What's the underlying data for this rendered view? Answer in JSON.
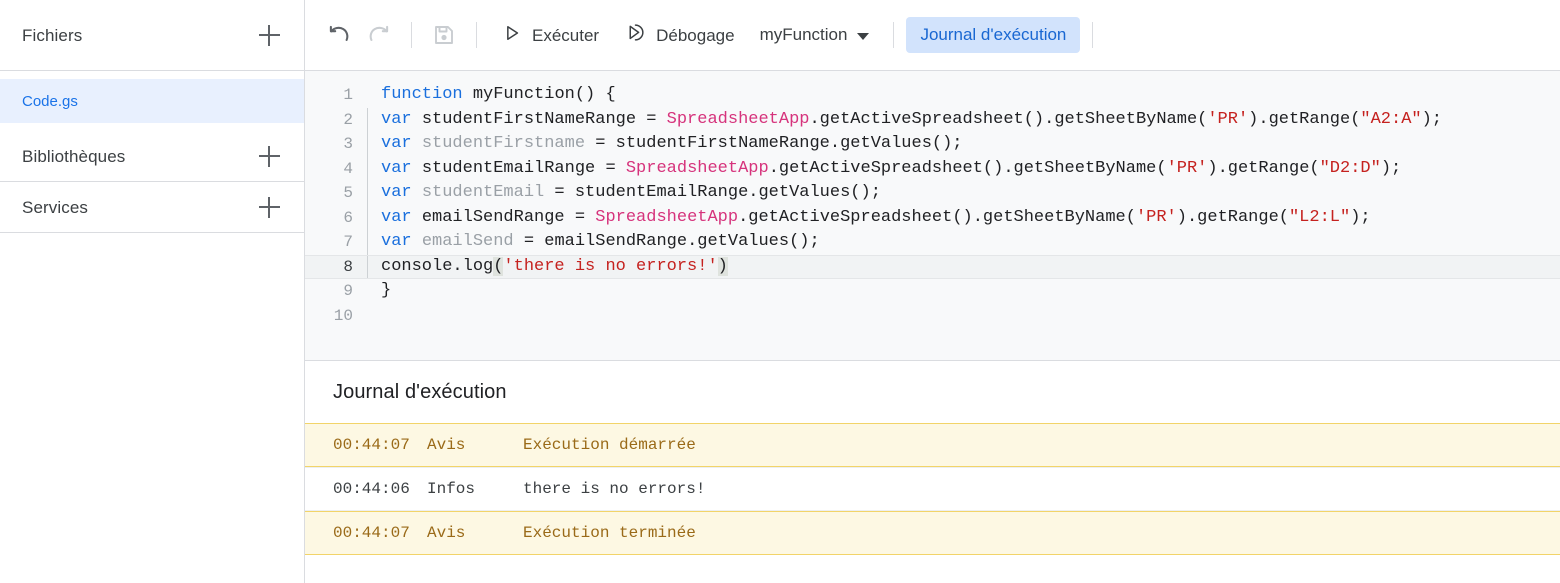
{
  "sidebar": {
    "sections": [
      {
        "title": "Fichiers",
        "add_icon": "plus-icon"
      },
      {
        "title": "Bibliothèques",
        "add_icon": "plus-icon"
      },
      {
        "title": "Services",
        "add_icon": "plus-icon"
      }
    ],
    "files": [
      {
        "name": "Code.gs",
        "selected": true
      }
    ]
  },
  "toolbar": {
    "undo_icon": "undo-icon",
    "redo_icon": "redo-icon",
    "save_icon": "save-icon",
    "run_label": "Exécuter",
    "run_icon": "play-icon",
    "debug_label": "Débogage",
    "debug_icon": "debug-icon",
    "function_selected": "myFunction",
    "function_caret_icon": "chevron-down-icon",
    "log_tab_label": "Journal d'exécution"
  },
  "editor": {
    "language": "javascript",
    "active_line": 8,
    "total_lines": 10,
    "lines": [
      {
        "n": "1",
        "depth": 0,
        "tokens": [
          {
            "t": "function ",
            "c": "kw"
          },
          {
            "t": "myFunction() {",
            "c": "plain"
          }
        ]
      },
      {
        "n": "2",
        "depth": 1,
        "tokens": [
          {
            "t": "var ",
            "c": "kw"
          },
          {
            "t": "studentFirstNameRange = ",
            "c": "plain"
          },
          {
            "t": "SpreadsheetApp",
            "c": "cls"
          },
          {
            "t": ".getActiveSpreadsheet().getSheetByName(",
            "c": "plain"
          },
          {
            "t": "'PR'",
            "c": "str"
          },
          {
            "t": ").getRange(",
            "c": "plain"
          },
          {
            "t": "\"A2:A\"",
            "c": "str"
          },
          {
            "t": ");",
            "c": "plain"
          }
        ]
      },
      {
        "n": "3",
        "depth": 1,
        "tokens": [
          {
            "t": "var ",
            "c": "kw"
          },
          {
            "t": "studentFirstname",
            "c": "dim"
          },
          {
            "t": " = studentFirstNameRange.getValues();",
            "c": "plain"
          }
        ]
      },
      {
        "n": "4",
        "depth": 1,
        "tokens": [
          {
            "t": "var ",
            "c": "kw"
          },
          {
            "t": "studentEmailRange = ",
            "c": "plain"
          },
          {
            "t": "SpreadsheetApp",
            "c": "cls"
          },
          {
            "t": ".getActiveSpreadsheet().getSheetByName(",
            "c": "plain"
          },
          {
            "t": "'PR'",
            "c": "str"
          },
          {
            "t": ").getRange(",
            "c": "plain"
          },
          {
            "t": "\"D2:D\"",
            "c": "str"
          },
          {
            "t": ");",
            "c": "plain"
          }
        ]
      },
      {
        "n": "5",
        "depth": 1,
        "tokens": [
          {
            "t": "var ",
            "c": "kw"
          },
          {
            "t": "studentEmail",
            "c": "dim"
          },
          {
            "t": " = studentEmailRange.getValues();",
            "c": "plain"
          }
        ]
      },
      {
        "n": "6",
        "depth": 1,
        "tokens": [
          {
            "t": "var ",
            "c": "kw"
          },
          {
            "t": "emailSendRange = ",
            "c": "plain"
          },
          {
            "t": "SpreadsheetApp",
            "c": "cls"
          },
          {
            "t": ".getActiveSpreadsheet().getSheetByName(",
            "c": "plain"
          },
          {
            "t": "'PR'",
            "c": "str"
          },
          {
            "t": ").getRange(",
            "c": "plain"
          },
          {
            "t": "\"L2:L\"",
            "c": "str"
          },
          {
            "t": ");",
            "c": "plain"
          }
        ]
      },
      {
        "n": "7",
        "depth": 1,
        "tokens": [
          {
            "t": "var ",
            "c": "kw"
          },
          {
            "t": "emailSend",
            "c": "dim"
          },
          {
            "t": " = emailSendRange.getValues();",
            "c": "plain"
          }
        ]
      },
      {
        "n": "8",
        "depth": 1,
        "active": true,
        "tokens": [
          {
            "t": "console.log",
            "c": "plain"
          },
          {
            "t": "(",
            "c": "br"
          },
          {
            "t": "'there is no errors!'",
            "c": "str"
          },
          {
            "t": ")",
            "c": "br"
          }
        ]
      },
      {
        "n": "9",
        "depth": 0,
        "tokens": [
          {
            "t": "}",
            "c": "plain"
          }
        ]
      },
      {
        "n": "10",
        "depth": 0,
        "tokens": [
          {
            "t": "",
            "c": "plain"
          }
        ]
      }
    ]
  },
  "log": {
    "title": "Journal d'exécution",
    "rows": [
      {
        "time": "00:44:07",
        "level": "Avis",
        "message": "Exécution démarrée",
        "type": "notice"
      },
      {
        "time": "00:44:06",
        "level": "Infos",
        "message": "there is no errors!",
        "type": "info"
      },
      {
        "time": "00:44:07",
        "level": "Avis",
        "message": "Exécution terminée",
        "type": "notice"
      }
    ]
  },
  "colors": {
    "accent_blue": "#1a73e8",
    "chip_bg": "#d2e3fc",
    "chip_text": "#1967d2",
    "selected_file_bg": "#e8f0fe",
    "editor_bg": "#f8f9fa",
    "notice_bg": "#fdf8e3",
    "notice_text": "#9a6a18",
    "notice_border": "#f2d469",
    "keyword": "#1a6fdd",
    "class_name": "#d6337c",
    "string": "#c5221f",
    "dimmed": "#9aa0a6",
    "text": "#202124",
    "border": "#dadce0"
  }
}
